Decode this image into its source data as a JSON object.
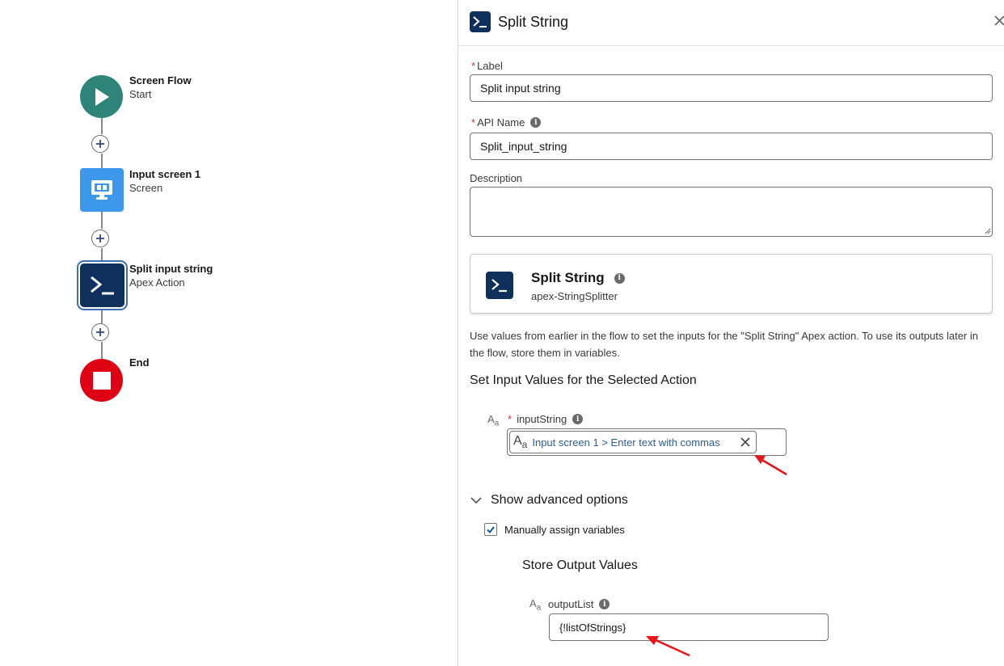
{
  "flow": {
    "nodes": [
      {
        "title": "Screen Flow",
        "subtitle": "Start"
      },
      {
        "title": "Input screen 1",
        "subtitle": "Screen"
      },
      {
        "title": "Split input string",
        "subtitle": "Apex Action"
      },
      {
        "title": "End",
        "subtitle": ""
      }
    ]
  },
  "panel": {
    "header_title": "Split String",
    "label_field": {
      "label": "Label",
      "required_mark": "*",
      "value": "Split input string"
    },
    "api_name_field": {
      "label": "API Name",
      "required_mark": "*",
      "value": "Split_input_string"
    },
    "description_field": {
      "label": "Description",
      "value": ""
    },
    "action_card": {
      "title": "Split String",
      "subtitle": "apex-StringSplitter"
    },
    "help_text": "Use values from earlier in the flow to set the inputs for the \"Split String\" Apex action. To use its outputs later in the flow, store them in variables.",
    "input_section_title": "Set Input Values for the Selected Action",
    "input_string": {
      "type_glyph": "A",
      "type_glyph_sub": "a",
      "required_mark": "*",
      "label": "inputString",
      "pill_value": "Input screen 1 > Enter text with commas"
    },
    "advanced_toggle_label": "Show advanced options",
    "manual_assign_label": "Manually assign variables",
    "manual_assign_checked": true,
    "output_section_title": "Store Output Values",
    "output_list": {
      "type_glyph": "A",
      "type_glyph_sub": "a",
      "label": "outputList",
      "value": "{!listOfStrings}"
    }
  },
  "colors": {
    "start_node": "#2e8479",
    "screen_node": "#3d98ec",
    "apex_node": "#0f2f5c",
    "end_node": "#e00014",
    "annotation_arrow": "#e8141b",
    "pill_text": "#2e5e99"
  },
  "icons": {
    "start": "play-icon",
    "screen": "monitor-icon",
    "apex": "terminal-icon",
    "end": "stop-icon",
    "add": "plus-icon",
    "close": "close-icon",
    "info": "info-icon",
    "chevron": "chevron-down-icon",
    "check": "check-icon"
  }
}
